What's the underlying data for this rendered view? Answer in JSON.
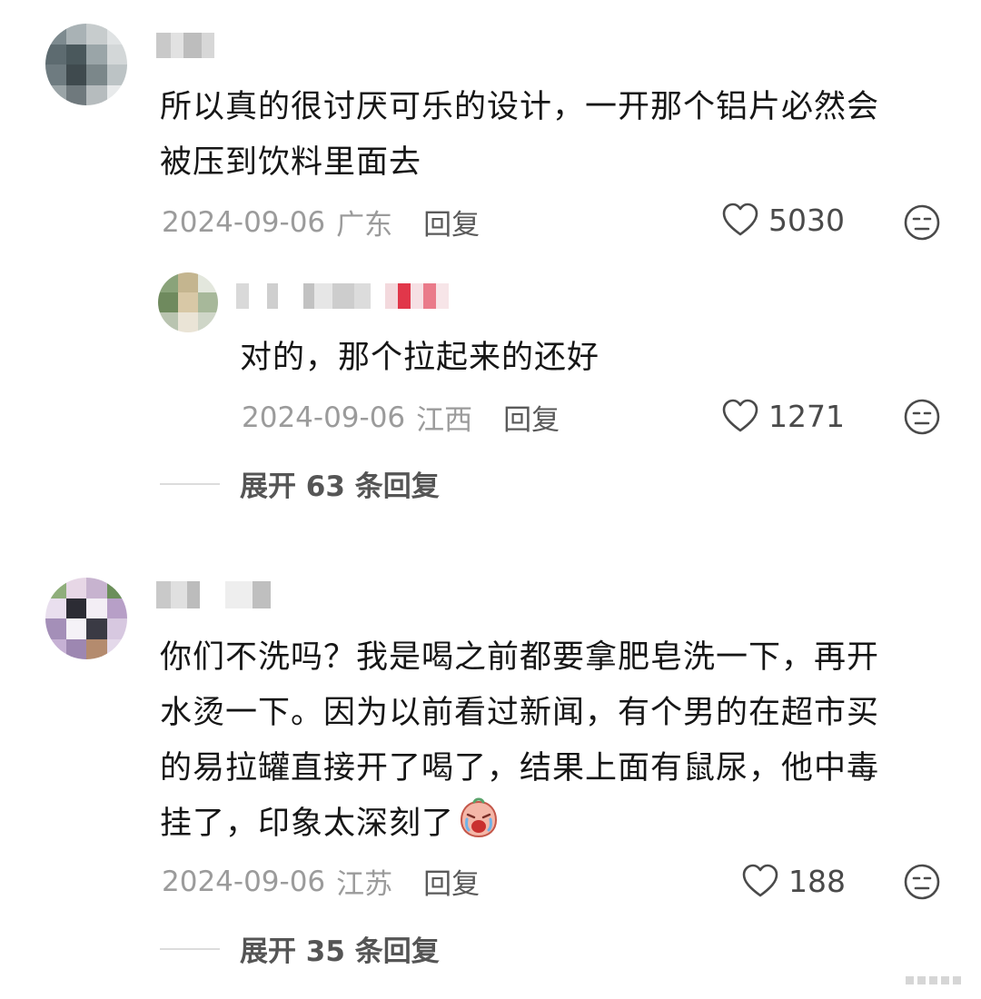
{
  "comments": [
    {
      "text_line1": "所以真的很讨厌可乐的设计，一开那个铝片必然会",
      "text_line2": "被压到饮料里面去",
      "date": "2024-09-06",
      "location": "广东",
      "reply_label": "回复",
      "likes": "5030",
      "reply": {
        "text": "对的，那个拉起来的还好",
        "date": "2024-09-06",
        "location": "江西",
        "reply_label": "回复",
        "likes": "1271"
      },
      "expand_label": "展开 63 条回复"
    },
    {
      "text_line1": "你们不洗吗？我是喝之前都要拿肥皂洗一下，再开",
      "text_line2": "水烫一下。因为以前看过新闻，有个男的在超市买",
      "text_line3": "的易拉罐直接开了喝了，结果上面有鼠尿，他中毒",
      "text_line4": "挂了，印象太深刻了",
      "emoji": "crying-face",
      "date": "2024-09-06",
      "location": "江苏",
      "reply_label": "回复",
      "likes": "188",
      "expand_label": "展开 35 条回复"
    }
  ],
  "icons": {
    "like": "heart-outline-icon",
    "dislike": "meh-face-icon"
  },
  "colors": {
    "text": "#161616",
    "meta": "#9b9b9b",
    "reply": "#5a5a5a",
    "divider": "#dcdcdc"
  }
}
